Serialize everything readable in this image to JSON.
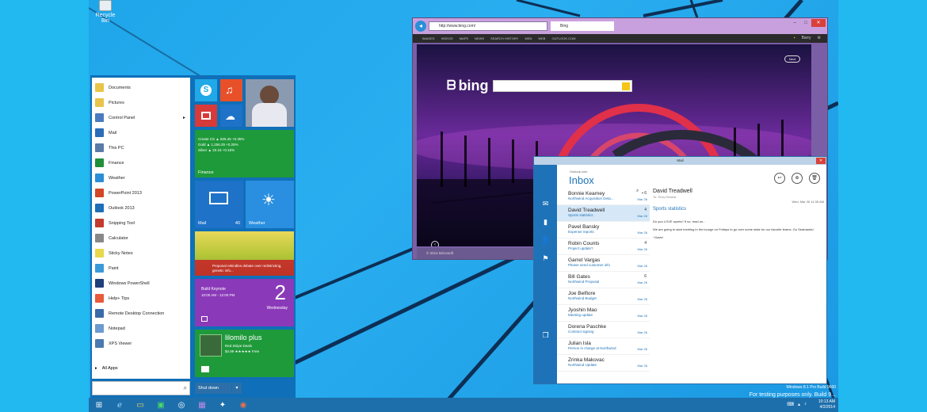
{
  "desktop": {
    "recycle_bin_label": "Recycle Bin",
    "watermark_line1": "Windows 8.1 Pro Build 9600",
    "watermark_line2": "For testing purposes only. Build 9..."
  },
  "start_menu": {
    "items": [
      {
        "label": "Documents",
        "color": "#e8c44a",
        "arrow": ""
      },
      {
        "label": "Pictures",
        "color": "#e8c44a",
        "arrow": ""
      },
      {
        "label": "Control Panel",
        "color": "#4a7bbf",
        "arrow": "▸"
      },
      {
        "label": "Mail",
        "color": "#2a6cb8",
        "arrow": ""
      },
      {
        "label": "This PC",
        "color": "#5a7aa8",
        "arrow": ""
      },
      {
        "label": "Finance",
        "color": "#1f8f3a",
        "arrow": ""
      },
      {
        "label": "Weather",
        "color": "#2a8fd8",
        "arrow": ""
      },
      {
        "label": "PowerPoint 2013",
        "color": "#d24726",
        "arrow": ""
      },
      {
        "label": "Outlook 2013",
        "color": "#1e6fb8",
        "arrow": ""
      },
      {
        "label": "Snipping Tool",
        "color": "#c23b2e",
        "arrow": ""
      },
      {
        "label": "Calculator",
        "color": "#888888",
        "arrow": ""
      },
      {
        "label": "Sticky Notes",
        "color": "#e8d84a",
        "arrow": ""
      },
      {
        "label": "Paint",
        "color": "#3a9ad8",
        "arrow": ""
      },
      {
        "label": "Windows PowerShell",
        "color": "#1e3f7a",
        "arrow": ""
      },
      {
        "label": "Help+ Tips",
        "color": "#e85a3a",
        "arrow": ""
      },
      {
        "label": "Remote Desktop Connection",
        "color": "#3a6aa8",
        "arrow": ""
      },
      {
        "label": "Notepad",
        "color": "#6a9ad0",
        "arrow": ""
      },
      {
        "label": "XPS Viewer",
        "color": "#4a7ab0",
        "arrow": ""
      }
    ],
    "all_apps": "All Apps",
    "shut_down": "Shut down",
    "tiles": {
      "finance_label": "Finance",
      "finance_rows": [
        "Create CS  ▲ 825.45  +0.35%",
        "Gold       ▲ 1,256.25 +0.25%",
        "Silver     ▲ 20.16  +0.15%"
      ],
      "mail_label": "Mail",
      "mail_count": "40",
      "weather_label": "Weather",
      "news_text": "Proposal rekindles debate over redistricting, genetic info...",
      "calendar_event": "Build Keynote",
      "calendar_time": "10:00 AM - 12:00 PM",
      "calendar_day_num": "2",
      "calendar_day_name": "Wednesday",
      "xbox_title": "lilomilo plus",
      "xbox_line1": "Red Stripe Deals",
      "xbox_line2": "$4.99 ★★★★★ Free"
    }
  },
  "browser": {
    "address": "http://www.bing.com/",
    "tab_label": "Bing",
    "nav_links": [
      "IMAGES",
      "VIDEOS",
      "MAPS",
      "NEWS",
      "SEARCH HISTORY",
      "MSN",
      "WEB",
      "OUTLOOK.COM"
    ],
    "user": "Barry",
    "logo_text": "bing",
    "page_button": "Next",
    "status_text": "© 2014 Microsoft"
  },
  "mail": {
    "window_title": "Mail",
    "account": "Outlook.com",
    "folder": "Inbox",
    "messages": [
      {
        "sender": "Bonnie Kearney",
        "subject": "Northwind Acquisition Deta...",
        "date": "Mar 26",
        "flag": "▪ 6"
      },
      {
        "sender": "David Treadwell",
        "subject": "Sports statistics",
        "date": "Mar 26",
        "flag": "4"
      },
      {
        "sender": "Pavel Bansky",
        "subject": "Expense reports",
        "date": "Mar 26",
        "flag": ""
      },
      {
        "sender": "Robin Counts",
        "subject": "Project update?",
        "date": "Mar 26",
        "flag": "4"
      },
      {
        "sender": "Garret Vargas",
        "subject": "Please send customer info",
        "date": "Mar 26",
        "flag": ""
      },
      {
        "sender": "Bill Gates",
        "subject": "Northwind Proposal",
        "date": "Mar 26",
        "flag": "6"
      },
      {
        "sender": "Joe Belfiore",
        "subject": "Northwind Budget",
        "date": "Mar 26",
        "flag": ""
      },
      {
        "sender": "Jyoshin Mao",
        "subject": "Meeting update",
        "date": "Mar 26",
        "flag": ""
      },
      {
        "sender": "Dorena Paschke",
        "subject": "Contract signing",
        "date": "Mar 26",
        "flag": ""
      },
      {
        "sender": "Julian Isla",
        "subject": "Person in charge at Northwind",
        "date": "Mar 26",
        "flag": ""
      },
      {
        "sender": "Zrinka Makovac",
        "subject": "Northwind Update",
        "date": "Mar 26",
        "flag": ""
      }
    ],
    "reader": {
      "from": "David Treadwell",
      "from_sub": "To: Terry Mcnear",
      "date": "Wed, Mar 26 11:35 AM",
      "subject": "Sports statistics",
      "body": [
        "Do you LOVE sports?  If so, read on...",
        "We are going to start meeting in the lounge on Fridays to go over some stats for our favorite teams.  Go Seahawks!",
        "~David"
      ]
    }
  },
  "taskbar": {
    "clock_time": "10:13 AM",
    "clock_date": "4/2/2014"
  }
}
